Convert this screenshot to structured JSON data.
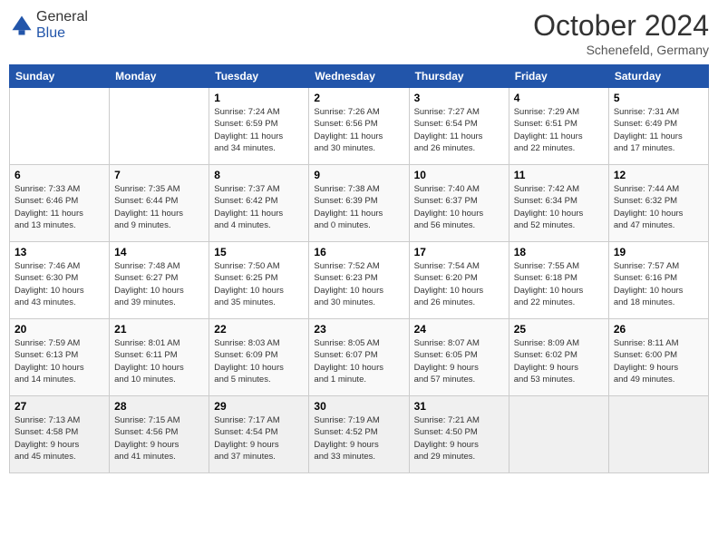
{
  "header": {
    "logo_general": "General",
    "logo_blue": "Blue",
    "month": "October 2024",
    "location": "Schenefeld, Germany"
  },
  "weekdays": [
    "Sunday",
    "Monday",
    "Tuesday",
    "Wednesday",
    "Thursday",
    "Friday",
    "Saturday"
  ],
  "weeks": [
    [
      {
        "day": "",
        "info": ""
      },
      {
        "day": "",
        "info": ""
      },
      {
        "day": "1",
        "info": "Sunrise: 7:24 AM\nSunset: 6:59 PM\nDaylight: 11 hours\nand 34 minutes."
      },
      {
        "day": "2",
        "info": "Sunrise: 7:26 AM\nSunset: 6:56 PM\nDaylight: 11 hours\nand 30 minutes."
      },
      {
        "day": "3",
        "info": "Sunrise: 7:27 AM\nSunset: 6:54 PM\nDaylight: 11 hours\nand 26 minutes."
      },
      {
        "day": "4",
        "info": "Sunrise: 7:29 AM\nSunset: 6:51 PM\nDaylight: 11 hours\nand 22 minutes."
      },
      {
        "day": "5",
        "info": "Sunrise: 7:31 AM\nSunset: 6:49 PM\nDaylight: 11 hours\nand 17 minutes."
      }
    ],
    [
      {
        "day": "6",
        "info": "Sunrise: 7:33 AM\nSunset: 6:46 PM\nDaylight: 11 hours\nand 13 minutes."
      },
      {
        "day": "7",
        "info": "Sunrise: 7:35 AM\nSunset: 6:44 PM\nDaylight: 11 hours\nand 9 minutes."
      },
      {
        "day": "8",
        "info": "Sunrise: 7:37 AM\nSunset: 6:42 PM\nDaylight: 11 hours\nand 4 minutes."
      },
      {
        "day": "9",
        "info": "Sunrise: 7:38 AM\nSunset: 6:39 PM\nDaylight: 11 hours\nand 0 minutes."
      },
      {
        "day": "10",
        "info": "Sunrise: 7:40 AM\nSunset: 6:37 PM\nDaylight: 10 hours\nand 56 minutes."
      },
      {
        "day": "11",
        "info": "Sunrise: 7:42 AM\nSunset: 6:34 PM\nDaylight: 10 hours\nand 52 minutes."
      },
      {
        "day": "12",
        "info": "Sunrise: 7:44 AM\nSunset: 6:32 PM\nDaylight: 10 hours\nand 47 minutes."
      }
    ],
    [
      {
        "day": "13",
        "info": "Sunrise: 7:46 AM\nSunset: 6:30 PM\nDaylight: 10 hours\nand 43 minutes."
      },
      {
        "day": "14",
        "info": "Sunrise: 7:48 AM\nSunset: 6:27 PM\nDaylight: 10 hours\nand 39 minutes."
      },
      {
        "day": "15",
        "info": "Sunrise: 7:50 AM\nSunset: 6:25 PM\nDaylight: 10 hours\nand 35 minutes."
      },
      {
        "day": "16",
        "info": "Sunrise: 7:52 AM\nSunset: 6:23 PM\nDaylight: 10 hours\nand 30 minutes."
      },
      {
        "day": "17",
        "info": "Sunrise: 7:54 AM\nSunset: 6:20 PM\nDaylight: 10 hours\nand 26 minutes."
      },
      {
        "day": "18",
        "info": "Sunrise: 7:55 AM\nSunset: 6:18 PM\nDaylight: 10 hours\nand 22 minutes."
      },
      {
        "day": "19",
        "info": "Sunrise: 7:57 AM\nSunset: 6:16 PM\nDaylight: 10 hours\nand 18 minutes."
      }
    ],
    [
      {
        "day": "20",
        "info": "Sunrise: 7:59 AM\nSunset: 6:13 PM\nDaylight: 10 hours\nand 14 minutes."
      },
      {
        "day": "21",
        "info": "Sunrise: 8:01 AM\nSunset: 6:11 PM\nDaylight: 10 hours\nand 10 minutes."
      },
      {
        "day": "22",
        "info": "Sunrise: 8:03 AM\nSunset: 6:09 PM\nDaylight: 10 hours\nand 5 minutes."
      },
      {
        "day": "23",
        "info": "Sunrise: 8:05 AM\nSunset: 6:07 PM\nDaylight: 10 hours\nand 1 minute."
      },
      {
        "day": "24",
        "info": "Sunrise: 8:07 AM\nSunset: 6:05 PM\nDaylight: 9 hours\nand 57 minutes."
      },
      {
        "day": "25",
        "info": "Sunrise: 8:09 AM\nSunset: 6:02 PM\nDaylight: 9 hours\nand 53 minutes."
      },
      {
        "day": "26",
        "info": "Sunrise: 8:11 AM\nSunset: 6:00 PM\nDaylight: 9 hours\nand 49 minutes."
      }
    ],
    [
      {
        "day": "27",
        "info": "Sunrise: 7:13 AM\nSunset: 4:58 PM\nDaylight: 9 hours\nand 45 minutes."
      },
      {
        "day": "28",
        "info": "Sunrise: 7:15 AM\nSunset: 4:56 PM\nDaylight: 9 hours\nand 41 minutes."
      },
      {
        "day": "29",
        "info": "Sunrise: 7:17 AM\nSunset: 4:54 PM\nDaylight: 9 hours\nand 37 minutes."
      },
      {
        "day": "30",
        "info": "Sunrise: 7:19 AM\nSunset: 4:52 PM\nDaylight: 9 hours\nand 33 minutes."
      },
      {
        "day": "31",
        "info": "Sunrise: 7:21 AM\nSunset: 4:50 PM\nDaylight: 9 hours\nand 29 minutes."
      },
      {
        "day": "",
        "info": ""
      },
      {
        "day": "",
        "info": ""
      }
    ]
  ]
}
